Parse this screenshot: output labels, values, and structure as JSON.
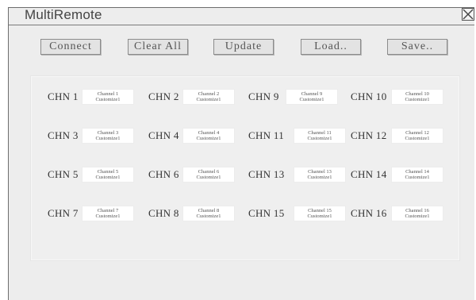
{
  "window": {
    "title": "MultiRemote"
  },
  "toolbar": {
    "connect_label": "Connect",
    "clear_label": "Clear All",
    "update_label": "Update",
    "load_label": "Load..",
    "save_label": "Save.."
  },
  "channels": [
    {
      "label": "CHN 1",
      "name": "Channel 1",
      "sub": "Customize1"
    },
    {
      "label": "CHN 2",
      "name": "Channel 2",
      "sub": "Customize1"
    },
    {
      "label": "CHN 9",
      "name": "Channel 9",
      "sub": "Customize1"
    },
    {
      "label": "CHN 10",
      "name": "Channel 10",
      "sub": "Customize1"
    },
    {
      "label": "CHN 3",
      "name": "Channel 3",
      "sub": "Customize1"
    },
    {
      "label": "CHN 4",
      "name": "Channel 4",
      "sub": "Customize1"
    },
    {
      "label": "CHN 11",
      "name": "Channel 11",
      "sub": "Customize1"
    },
    {
      "label": "CHN 12",
      "name": "Channel 12",
      "sub": "Customize1"
    },
    {
      "label": "CHN 5",
      "name": "Channel 5",
      "sub": "Customize1"
    },
    {
      "label": "CHN 6",
      "name": "Channel 6",
      "sub": "Customize1"
    },
    {
      "label": "CHN 13",
      "name": "Channel 13",
      "sub": "Customize1"
    },
    {
      "label": "CHN 14",
      "name": "Channel 14",
      "sub": "Customize1"
    },
    {
      "label": "CHN 7",
      "name": "Channel 7",
      "sub": "Customize1"
    },
    {
      "label": "CHN 8",
      "name": "Channel 8",
      "sub": "Customize1"
    },
    {
      "label": "CHN 15",
      "name": "Channel 15",
      "sub": "Customize1"
    },
    {
      "label": "CHN 16",
      "name": "Channel 16",
      "sub": "Customize1"
    }
  ]
}
